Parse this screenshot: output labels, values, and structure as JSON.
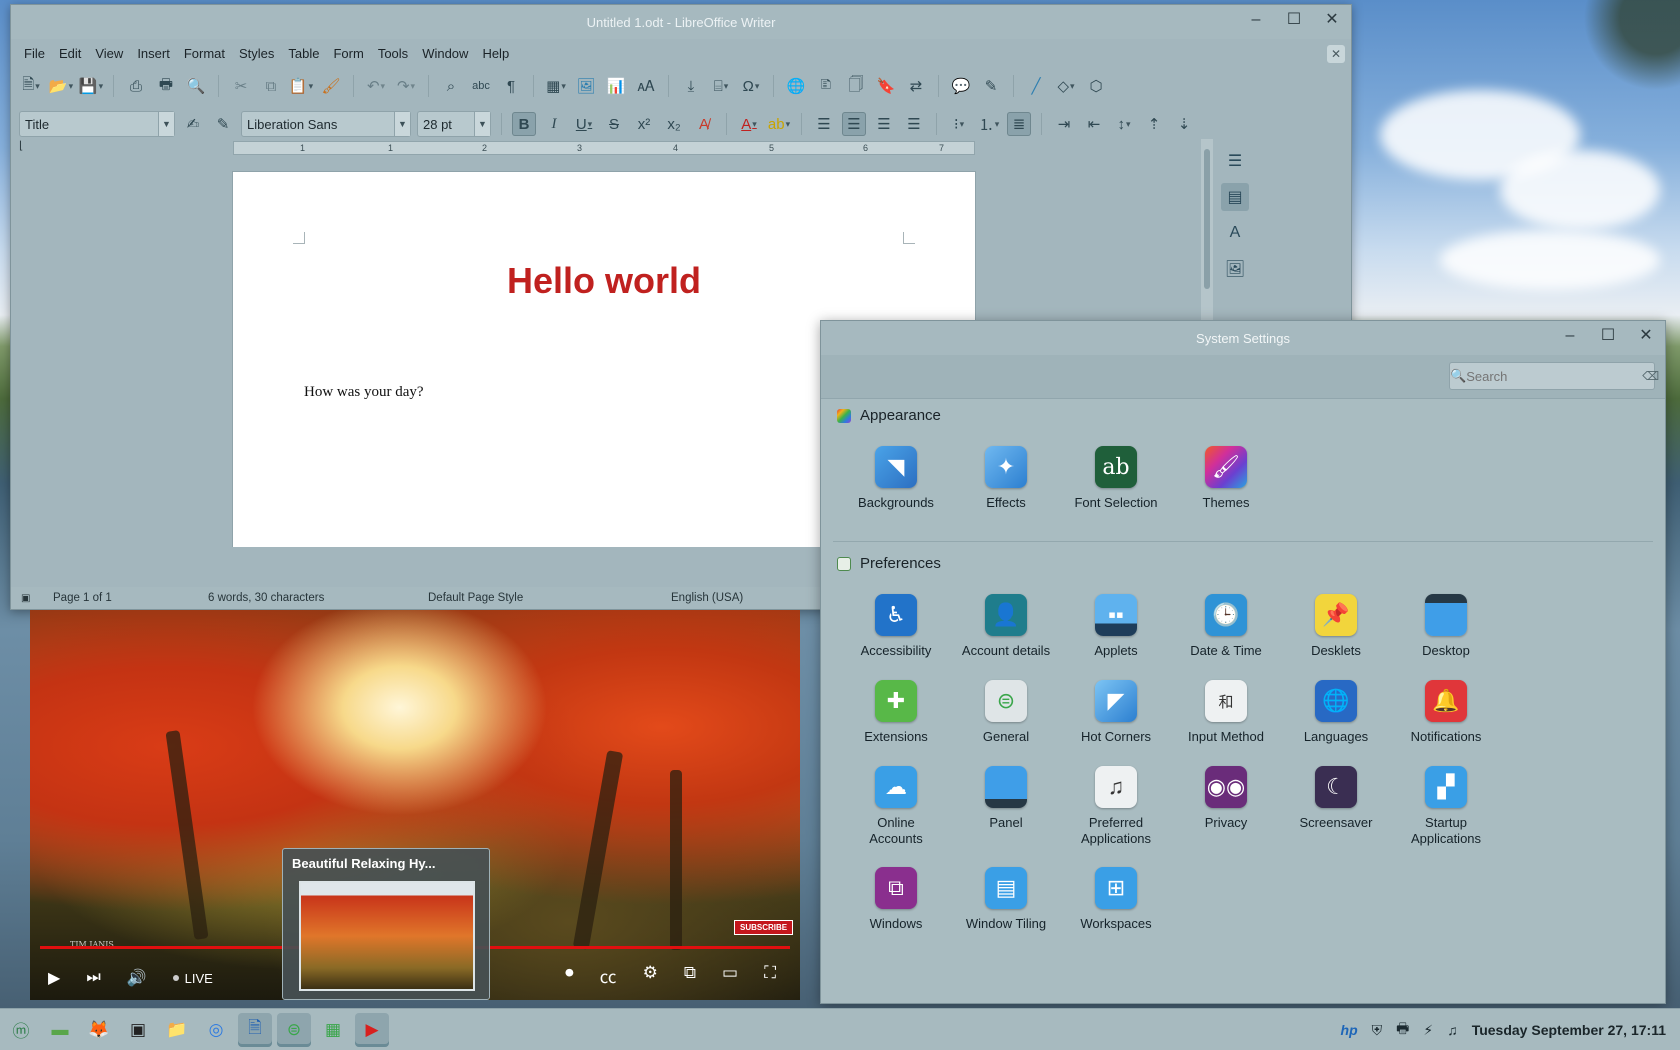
{
  "writer": {
    "title": "Untitled 1.odt - LibreOffice Writer",
    "menus": [
      "File",
      "Edit",
      "View",
      "Insert",
      "Format",
      "Styles",
      "Table",
      "Form",
      "Tools",
      "Window",
      "Help"
    ],
    "paragraph_style": "Title",
    "font_name": "Liberation Sans",
    "font_size": "28 pt",
    "ruler_numbers": [
      "1",
      "1",
      "2",
      "3",
      "4",
      "5",
      "6",
      "7"
    ],
    "document": {
      "title": "Hello world",
      "body": "How was your day?"
    },
    "status": {
      "page": "Page 1 of 1",
      "words": "6 words, 30 characters",
      "page_style": "Default Page Style",
      "language": "English (USA)"
    }
  },
  "video": {
    "status": "LIVE",
    "subscribe": "SUBSCRIBE",
    "signature": "TIM JANIS",
    "preview_title": "Beautiful Relaxing Hy..."
  },
  "settings": {
    "title": "System Settings",
    "search_placeholder": "Search",
    "sections": {
      "appearance": {
        "label": "Appearance",
        "items": [
          {
            "label": "Backgrounds",
            "icon": "backgrounds-icon"
          },
          {
            "label": "Effects",
            "icon": "effects-icon"
          },
          {
            "label": "Font Selection",
            "icon": "font-selection-icon"
          },
          {
            "label": "Themes",
            "icon": "themes-icon"
          }
        ]
      },
      "preferences": {
        "label": "Preferences",
        "items": [
          {
            "label": "Accessibility",
            "icon": "accessibility-icon"
          },
          {
            "label": "Account details",
            "icon": "account-details-icon"
          },
          {
            "label": "Applets",
            "icon": "applets-icon"
          },
          {
            "label": "Date & Time",
            "icon": "date-time-icon"
          },
          {
            "label": "Desklets",
            "icon": "desklets-icon"
          },
          {
            "label": "Desktop",
            "icon": "desktop-icon"
          },
          {
            "label": "Extensions",
            "icon": "extensions-icon"
          },
          {
            "label": "General",
            "icon": "general-icon"
          },
          {
            "label": "Hot Corners",
            "icon": "hot-corners-icon"
          },
          {
            "label": "Input Method",
            "icon": "input-method-icon"
          },
          {
            "label": "Languages",
            "icon": "languages-icon"
          },
          {
            "label": "Notifications",
            "icon": "notifications-icon"
          },
          {
            "label": "Online\nAccounts",
            "icon": "online-accounts-icon"
          },
          {
            "label": "Panel",
            "icon": "panel-icon"
          },
          {
            "label": "Preferred\nApplications",
            "icon": "preferred-applications-icon"
          },
          {
            "label": "Privacy",
            "icon": "privacy-icon"
          },
          {
            "label": "Screensaver",
            "icon": "screensaver-icon"
          },
          {
            "label": "Startup\nApplications",
            "icon": "startup-applications-icon"
          },
          {
            "label": "Windows",
            "icon": "windows-icon"
          },
          {
            "label": "Window Tiling",
            "icon": "window-tiling-icon"
          },
          {
            "label": "Workspaces",
            "icon": "workspaces-icon"
          }
        ]
      }
    }
  },
  "taskbar": {
    "clock": "Tuesday September 27, 17:11"
  },
  "colors": {
    "title_red": "#c0211f",
    "accent_blue": "#3a8fd8"
  }
}
